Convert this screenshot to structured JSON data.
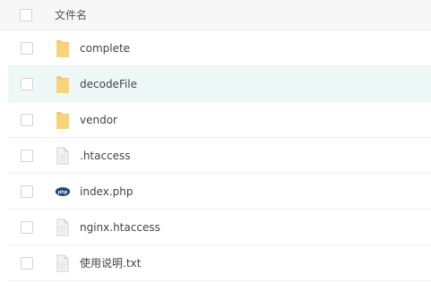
{
  "header": {
    "column_label": "文件名"
  },
  "files": [
    {
      "name": "complete",
      "type": "folder",
      "selected": false
    },
    {
      "name": "decodeFile",
      "type": "folder",
      "selected": true
    },
    {
      "name": "vendor",
      "type": "folder",
      "selected": false
    },
    {
      "name": ".htaccess",
      "type": "file",
      "selected": false
    },
    {
      "name": "index.php",
      "type": "php",
      "selected": false
    },
    {
      "name": "nginx.htaccess",
      "type": "file",
      "selected": false
    },
    {
      "name": "使用说明.txt",
      "type": "file",
      "selected": false
    }
  ],
  "colors": {
    "folder": "#f5c85f",
    "php_badge": "#27457a",
    "selected_row": "#eef9f7"
  },
  "icons": {
    "php_badge_text": "php"
  }
}
